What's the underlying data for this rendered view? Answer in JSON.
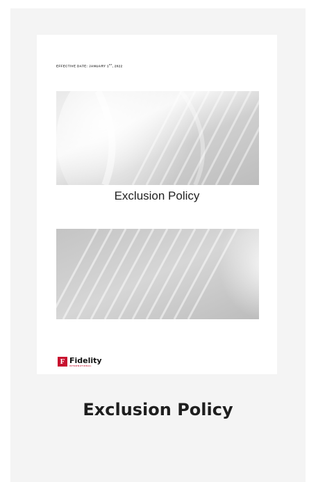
{
  "document": {
    "effective_date_label": "EFFECTIVE DATE: JANUARY 1",
    "effective_date_suffix": "ST",
    "effective_date_year": ", 2022",
    "title": "Exclusion Policy",
    "logo": {
      "mark": "F",
      "name": "Fidelity",
      "subtitle": "INTERNATIONAL"
    }
  },
  "caption": "Exclusion Policy",
  "colors": {
    "brand_red": "#c8102e",
    "card_background": "#f4f4f4",
    "banner_grey": "#c9c9c9"
  }
}
